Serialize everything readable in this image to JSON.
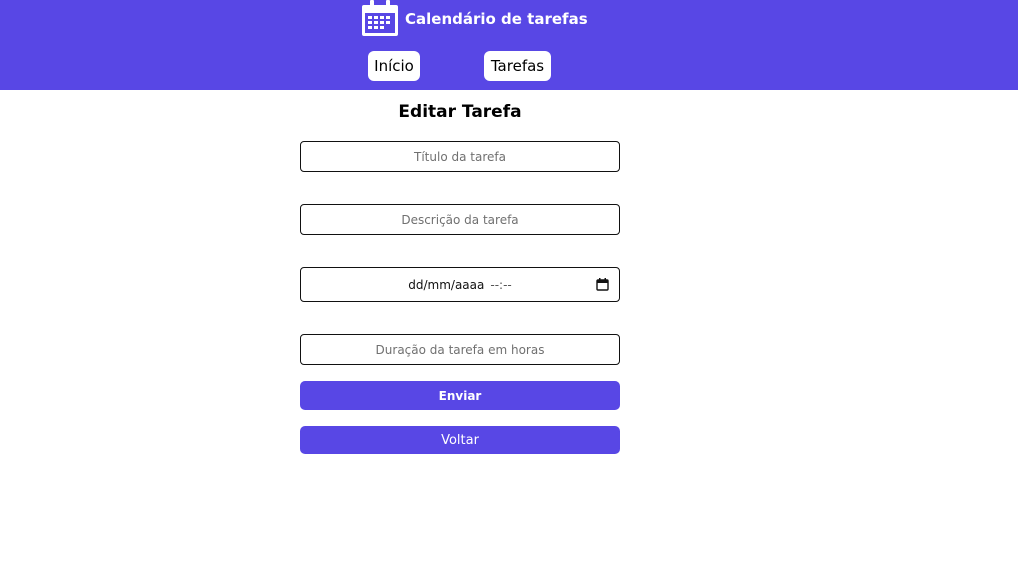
{
  "header": {
    "title": "Calendário de tarefas",
    "logo_icon": "calendar-icon",
    "background": "#5847e5",
    "nav": [
      {
        "label": "Início"
      },
      {
        "label": "Tarefas"
      }
    ]
  },
  "form": {
    "title": "Editar Tarefa",
    "titulo_placeholder": "Título da tarefa",
    "descricao_placeholder": "Descrição da tarefa",
    "data_date": "dd/mm/aaaa",
    "data_time": "--:--",
    "data_icon": "calendar-icon",
    "duracao_placeholder": "Duração da tarefa em horas",
    "submit_label": "Enviar",
    "back_label": "Voltar",
    "accent": "#5847e5"
  }
}
